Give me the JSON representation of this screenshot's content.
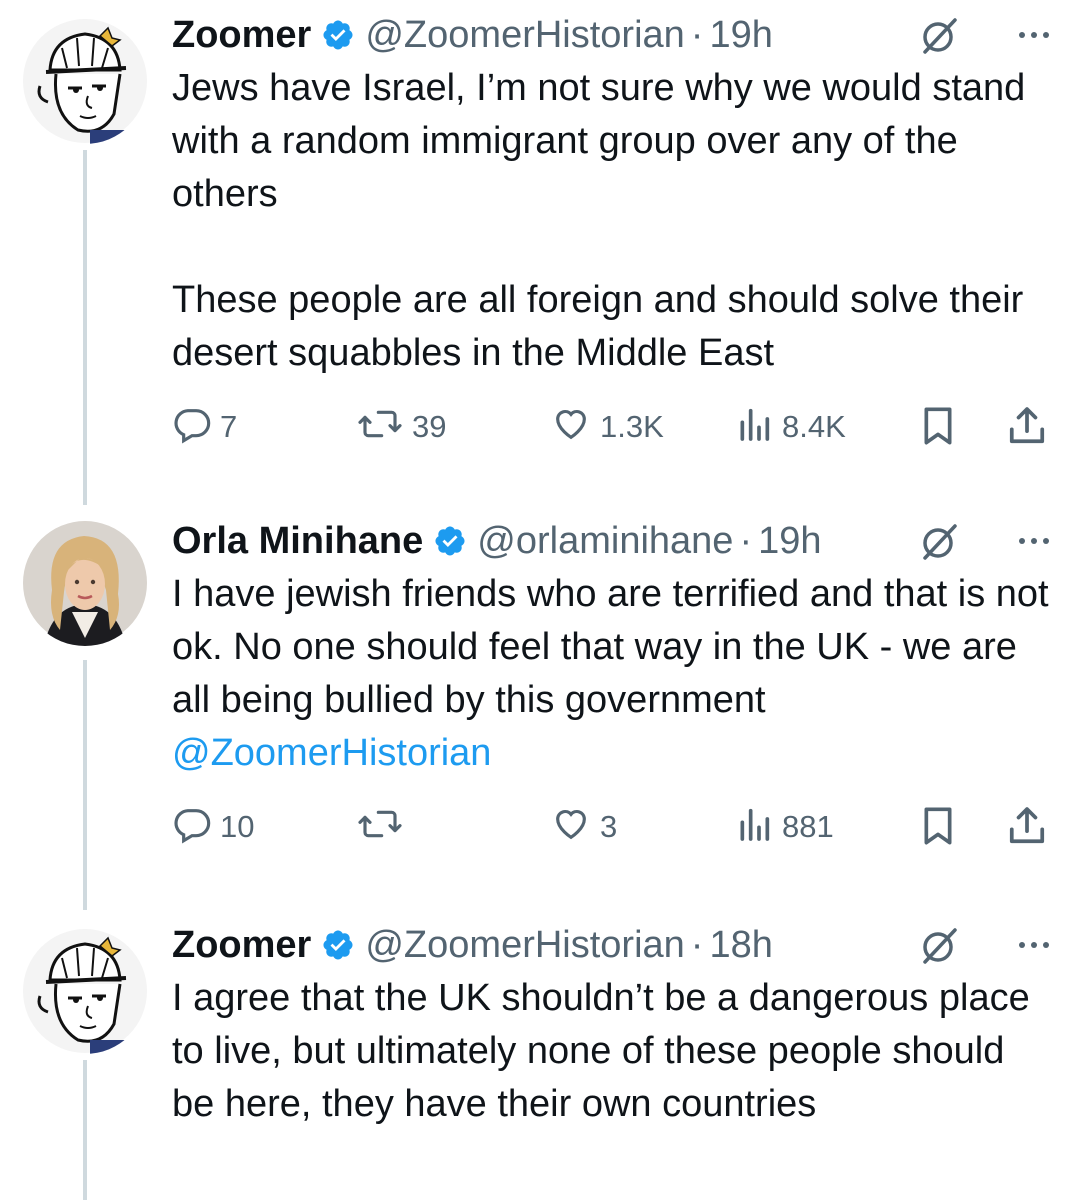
{
  "tweets": [
    {
      "name": "Zoomer",
      "handle": "@ZoomerHistorian",
      "dot": "·",
      "time": "19h",
      "text": "Jews have Israel, I’m not sure why we would stand with a random immigrant group over any of the others\n\nThese people are all foreign and should solve their desert squabbles in the Middle East",
      "mention": "",
      "replies": "7",
      "reposts": "39",
      "likes": "1.3K",
      "views": "8.4K"
    },
    {
      "name": "Orla Minihane",
      "handle": "@orlaminihane",
      "dot": "·",
      "time": "19h",
      "text": "I have jewish friends who are terrified and that is not ok. No one should feel that way in the UK - we are all being bullied by this government ",
      "mention": "@ZoomerHistorian",
      "replies": "10",
      "reposts": "",
      "likes": "3",
      "views": "881"
    },
    {
      "name": "Zoomer",
      "handle": "@ZoomerHistorian",
      "dot": "·",
      "time": "18h",
      "text": "I agree that the UK shouldn’t be a dangerous place to live, but ultimately none of these people should be here, they have their own countries",
      "mention": ""
    }
  ],
  "icons": {
    "verified": "verified-badge-icon",
    "grok": "grok-icon",
    "more": "more-icon",
    "reply": "reply-icon",
    "repost": "repost-icon",
    "like": "like-icon",
    "views": "views-icon",
    "bookmark": "bookmark-icon",
    "share": "share-icon"
  },
  "colors": {
    "text": "#0f1419",
    "secondary": "#536471",
    "accent": "#1d9bf0",
    "thread_line": "#cfd9de"
  }
}
